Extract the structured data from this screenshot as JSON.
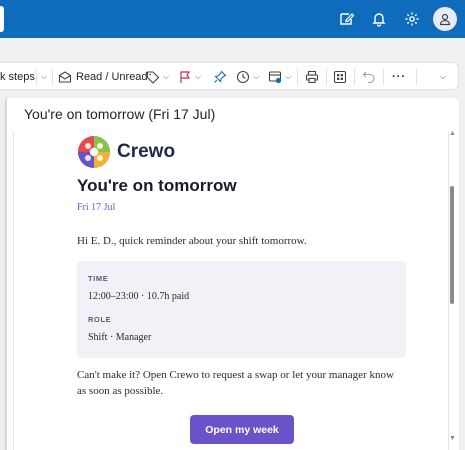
{
  "toolbar": {
    "steps_fragment": "k steps",
    "read_unread_label": "Read / Unread",
    "more_label": "···"
  },
  "message": {
    "subject": "You're on tomorrow (Fri 17 Jul)"
  },
  "email": {
    "brand": "Crewo",
    "heading": "You're on tomorrow",
    "date": "Fri 17 Jul",
    "greeting": "Hi E. D., quick reminder about your shift tomorrow.",
    "time_label": "TIME",
    "time_value": "12:00–23:00 · 10.7h paid",
    "role_label": "ROLE",
    "role_value": "Shift · Manager",
    "closing": "Can't make it? Open Crewo to request a swap or let your manager know as soon as possible.",
    "cta_label": "Open my week"
  },
  "colors": {
    "app_bar": "#0f6cbd",
    "accent": "#6a52c9",
    "date_accent": "#6b5bd2"
  },
  "icons": [
    "compose-icon",
    "bell-icon",
    "gear-icon",
    "account-icon",
    "envelope-icon",
    "tag-icon",
    "flag-icon",
    "pin-icon",
    "clock-icon",
    "move-icon",
    "print-icon",
    "immersive-reader-icon",
    "undo-icon"
  ]
}
